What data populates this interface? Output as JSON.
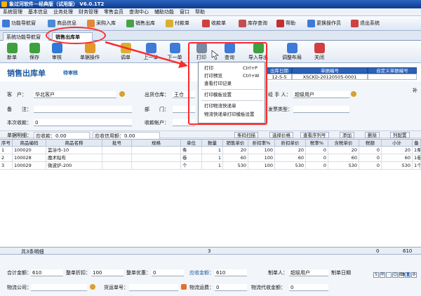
{
  "window": {
    "title": "象过河软件－经典版（试用版） V6.0.1T2"
  },
  "menu": [
    "系统管理",
    "基本信息",
    "业务处理",
    "财务管理",
    "零售会员",
    "查询中心",
    "辅助功能",
    "窗口",
    "帮助"
  ],
  "toolbar1": [
    {
      "label": "功能导航窗",
      "icon": "home-icon",
      "color": "#3e7ad6"
    },
    {
      "label": "商品信息",
      "icon": "goods-icon",
      "color": "#4a8ad6"
    },
    {
      "label": "采购入库",
      "icon": "purchase-icon",
      "color": "#e0883a"
    },
    {
      "label": "销售出库",
      "icon": "sale-icon",
      "color": "#4aa04a"
    },
    {
      "label": "付款单",
      "icon": "pay-icon",
      "color": "#d8b030"
    },
    {
      "label": "收款单",
      "icon": "receive-icon",
      "color": "#d04040"
    },
    {
      "label": "库存查询",
      "icon": "stock-icon",
      "color": "#c05050"
    },
    {
      "label": "帮助",
      "icon": "help-icon",
      "color": "#c03030"
    },
    {
      "label": "更换操作员",
      "icon": "switch-user-icon",
      "color": "#3e7ad6"
    },
    {
      "label": "退出系统",
      "icon": "exit-icon",
      "color": "#d04040"
    }
  ],
  "tabs": [
    {
      "label": "系统功能导航窗"
    },
    {
      "label": "销售出库单"
    }
  ],
  "toolbar2": [
    {
      "label": "新单",
      "icon": "new-icon",
      "color": "#3ea03e"
    },
    {
      "label": "保存",
      "icon": "save-icon",
      "color": "#3ea03e"
    },
    {
      "label": "审核",
      "icon": "audit-icon",
      "color": "#2e7ad6"
    },
    {
      "label": "单据操作",
      "icon": "doc-ops-icon",
      "color": "#e09a2a"
    },
    {
      "label": "调单",
      "icon": "fetch-icon",
      "color": "#d8b030"
    },
    {
      "label": "上一单",
      "icon": "prev-icon",
      "color": "#3e7ad6"
    },
    {
      "label": "下一单",
      "icon": "next-icon",
      "color": "#3e7ad6"
    },
    {
      "label": "打印",
      "icon": "printer-icon",
      "color": "#7a8aa0"
    },
    {
      "label": "查询",
      "icon": "query-icon",
      "color": "#3e7ad6"
    },
    {
      "label": "导入导出",
      "icon": "import-export-icon",
      "color": "#3ea03e"
    },
    {
      "label": "调整布局",
      "icon": "layout-icon",
      "color": "#3e7ad6"
    },
    {
      "label": "关闭",
      "icon": "close-icon",
      "color": "#d04040"
    }
  ],
  "page": {
    "title": "销售出库单",
    "status": "待审核"
  },
  "docinfo": {
    "date_label": "出库日期",
    "number_label": "单据编号",
    "custom_label": "自定义单据编号",
    "date_value": "12-5-5",
    "number_value": "XSCKD-20120505-0001",
    "custom_value": ""
  },
  "form": {
    "customer_label": "客　户：",
    "customer_value": "华北客户",
    "warehouse_label": "出货仓库：",
    "warehouse_value": "王仓",
    "handler_label": "经 手 人：",
    "handler_value": "超级用户",
    "remark_label": "备　　注：",
    "remark_value": "",
    "dept_label": "部　　门：",
    "dept_value": "",
    "invoice_label": "发票类型：",
    "invoice_value": "",
    "collected_label": "本次收款：",
    "collected_value": "0",
    "account_label": "收款帐户：",
    "account_value": "",
    "detail_label": "单据明细：",
    "receivable": "应收款：0.00",
    "credit": "应收信用额：0.00",
    "supplement_label": "补"
  },
  "grid_buttons": [
    "条码扫描",
    "选择价格",
    "查看序列号",
    "添加",
    "删除",
    "列配置"
  ],
  "grid": {
    "columns": [
      "序号",
      "商品编码",
      "商品名称",
      "批号",
      "规格",
      "单位",
      "数量",
      "销售单价",
      "折扣率%",
      "折扣单价",
      "税率%",
      "含税单价",
      "税额",
      "小计",
      "备"
    ],
    "rows": [
      [
        "1",
        "100020",
        "篮浴巾-10",
        "",
        "",
        "条",
        "1",
        "20",
        "100",
        "20",
        "0",
        "20",
        "0",
        "20",
        "1条"
      ],
      [
        "2",
        "100028",
        "魔术贴布",
        "",
        "",
        "卷",
        "1",
        "60",
        "100",
        "60",
        "0",
        "60",
        "0",
        "60",
        "1卷"
      ],
      [
        "3",
        "100029",
        "微波炉-200",
        "",
        "",
        "个",
        "1",
        "530",
        "100",
        "530",
        "0",
        "530",
        "0",
        "530",
        "1个"
      ]
    ],
    "summary": {
      "label": "共3条明细",
      "qty": "3",
      "tax": "0",
      "subtotal": "610"
    }
  },
  "footer": {
    "total_label": "合计金额：",
    "total": "610",
    "discount_label": "整单折扣：",
    "discount": "100",
    "promo_label": "整单优惠：",
    "promo": "0",
    "receivable_label": "应收金额：",
    "receivable": "610",
    "maker_label": "制单人：",
    "maker": "超级用户",
    "makedate_label": "制单日期",
    "logistics_label": "物流公司：",
    "logistics": "",
    "shipno_label": "货运单号：",
    "shipno": "",
    "freight_label": "物流运费：",
    "freight": "0",
    "cod_label": "物流代收金额：",
    "cod": "0"
  },
  "print_menu": [
    {
      "label": "打印",
      "shortcut": "Ctrl+P"
    },
    {
      "label": "打印预览",
      "shortcut": "Ctrl+W"
    },
    {
      "label": "查看打印记录",
      "shortcut": ""
    },
    {
      "label": "打印模板设置",
      "shortcut": ""
    },
    {
      "label": "打印物流快递单",
      "shortcut": ""
    },
    {
      "label": "物流快递单打印模板设置",
      "shortcut": ""
    }
  ],
  "ime": [
    "S",
    "中",
    "·",
    "☺",
    "⌨",
    "👤",
    "⚙"
  ],
  "colors": {
    "accent": "#1a5aa0",
    "header_blue": "#2b62b8",
    "highlight": "#ff2a2a"
  }
}
